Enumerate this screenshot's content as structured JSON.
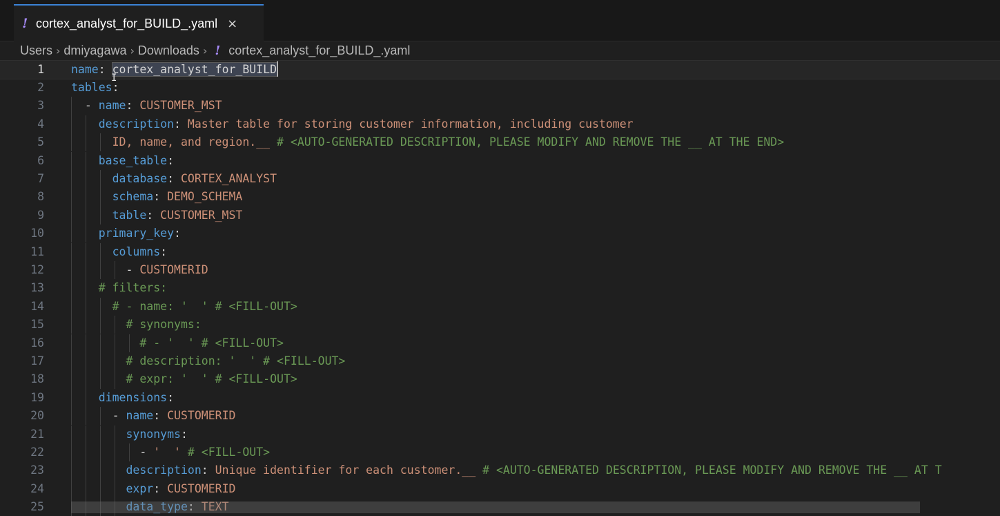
{
  "tab": {
    "icon": "!",
    "title": "cortex_analyst_for_BUILD_.yaml",
    "close": "×"
  },
  "breadcrumb": {
    "items": [
      "Users",
      "dmiyagawa",
      "Downloads"
    ],
    "file_icon": "!",
    "file": "cortex_analyst_for_BUILD_.yaml",
    "separator": "›"
  },
  "editor": {
    "current_line": 1,
    "lines": [
      {
        "n": "1",
        "indent": 0,
        "tokens": [
          [
            "k",
            "name"
          ],
          [
            "p",
            ": "
          ],
          [
            "sel",
            "cortex_analyst_for_BUILD"
          ],
          [
            "cur",
            ""
          ]
        ]
      },
      {
        "n": "2",
        "indent": 0,
        "tokens": [
          [
            "k",
            "tables"
          ],
          [
            "p",
            ":"
          ]
        ]
      },
      {
        "n": "3",
        "indent": 1,
        "tokens": [
          [
            "p",
            "  - "
          ],
          [
            "k",
            "name"
          ],
          [
            "p",
            ": "
          ],
          [
            "v",
            "CUSTOMER_MST"
          ]
        ]
      },
      {
        "n": "4",
        "indent": 2,
        "tokens": [
          [
            "p",
            "    "
          ],
          [
            "k",
            "description"
          ],
          [
            "p",
            ": "
          ],
          [
            "v",
            "Master table for storing customer information, including customer"
          ]
        ]
      },
      {
        "n": "5",
        "indent": 3,
        "tokens": [
          [
            "p",
            "      "
          ],
          [
            "v",
            "ID, name, and region.__"
          ],
          [
            "p",
            " "
          ],
          [
            "c",
            "# <AUTO-GENERATED DESCRIPTION, PLEASE MODIFY AND REMOVE THE __ AT THE END>"
          ]
        ]
      },
      {
        "n": "6",
        "indent": 2,
        "tokens": [
          [
            "p",
            "    "
          ],
          [
            "k",
            "base_table"
          ],
          [
            "p",
            ":"
          ]
        ]
      },
      {
        "n": "7",
        "indent": 3,
        "tokens": [
          [
            "p",
            "      "
          ],
          [
            "k",
            "database"
          ],
          [
            "p",
            ": "
          ],
          [
            "v",
            "CORTEX_ANALYST"
          ]
        ]
      },
      {
        "n": "8",
        "indent": 3,
        "tokens": [
          [
            "p",
            "      "
          ],
          [
            "k",
            "schema"
          ],
          [
            "p",
            ": "
          ],
          [
            "v",
            "DEMO_SCHEMA"
          ]
        ]
      },
      {
        "n": "9",
        "indent": 3,
        "tokens": [
          [
            "p",
            "      "
          ],
          [
            "k",
            "table"
          ],
          [
            "p",
            ": "
          ],
          [
            "v",
            "CUSTOMER_MST"
          ]
        ]
      },
      {
        "n": "10",
        "indent": 2,
        "tokens": [
          [
            "p",
            "    "
          ],
          [
            "k",
            "primary_key"
          ],
          [
            "p",
            ":"
          ]
        ]
      },
      {
        "n": "11",
        "indent": 3,
        "tokens": [
          [
            "p",
            "      "
          ],
          [
            "k",
            "columns"
          ],
          [
            "p",
            ":"
          ]
        ]
      },
      {
        "n": "12",
        "indent": 4,
        "tokens": [
          [
            "p",
            "        - "
          ],
          [
            "v",
            "CUSTOMERID"
          ]
        ]
      },
      {
        "n": "13",
        "indent": 2,
        "tokens": [
          [
            "p",
            "    "
          ],
          [
            "c",
            "# filters:"
          ]
        ]
      },
      {
        "n": "14",
        "indent": 3,
        "tokens": [
          [
            "p",
            "      "
          ],
          [
            "c",
            "# - name: '  ' # <FILL-OUT>"
          ]
        ]
      },
      {
        "n": "15",
        "indent": 4,
        "tokens": [
          [
            "p",
            "        "
          ],
          [
            "c",
            "# synonyms:"
          ]
        ]
      },
      {
        "n": "16",
        "indent": 5,
        "tokens": [
          [
            "p",
            "          "
          ],
          [
            "c",
            "# - '  ' # <FILL-OUT>"
          ]
        ]
      },
      {
        "n": "17",
        "indent": 4,
        "tokens": [
          [
            "p",
            "        "
          ],
          [
            "c",
            "# description: '  ' # <FILL-OUT>"
          ]
        ]
      },
      {
        "n": "18",
        "indent": 4,
        "tokens": [
          [
            "p",
            "        "
          ],
          [
            "c",
            "# expr: '  ' # <FILL-OUT>"
          ]
        ]
      },
      {
        "n": "19",
        "indent": 2,
        "tokens": [
          [
            "p",
            "    "
          ],
          [
            "k",
            "dimensions"
          ],
          [
            "p",
            ":"
          ]
        ]
      },
      {
        "n": "20",
        "indent": 3,
        "tokens": [
          [
            "p",
            "      - "
          ],
          [
            "k",
            "name"
          ],
          [
            "p",
            ": "
          ],
          [
            "v",
            "CUSTOMERID"
          ]
        ]
      },
      {
        "n": "21",
        "indent": 4,
        "tokens": [
          [
            "p",
            "        "
          ],
          [
            "k",
            "synonyms"
          ],
          [
            "p",
            ":"
          ]
        ]
      },
      {
        "n": "22",
        "indent": 5,
        "tokens": [
          [
            "p",
            "          - "
          ],
          [
            "v",
            "'  '"
          ],
          [
            "p",
            " "
          ],
          [
            "c",
            "# <FILL-OUT>"
          ]
        ]
      },
      {
        "n": "23",
        "indent": 4,
        "tokens": [
          [
            "p",
            "        "
          ],
          [
            "k",
            "description"
          ],
          [
            "p",
            ": "
          ],
          [
            "v",
            "Unique identifier for each customer.__"
          ],
          [
            "p",
            " "
          ],
          [
            "c",
            "# <AUTO-GENERATED DESCRIPTION, PLEASE MODIFY AND REMOVE THE __ AT T"
          ]
        ]
      },
      {
        "n": "24",
        "indent": 4,
        "tokens": [
          [
            "p",
            "        "
          ],
          [
            "k",
            "expr"
          ],
          [
            "p",
            ": "
          ],
          [
            "v",
            "CUSTOMERID"
          ]
        ]
      },
      {
        "n": "25",
        "indent": 4,
        "tokens": [
          [
            "p",
            "        "
          ],
          [
            "k",
            "data_type"
          ],
          [
            "p",
            ": "
          ],
          [
            "v",
            "TEXT"
          ]
        ]
      }
    ]
  }
}
